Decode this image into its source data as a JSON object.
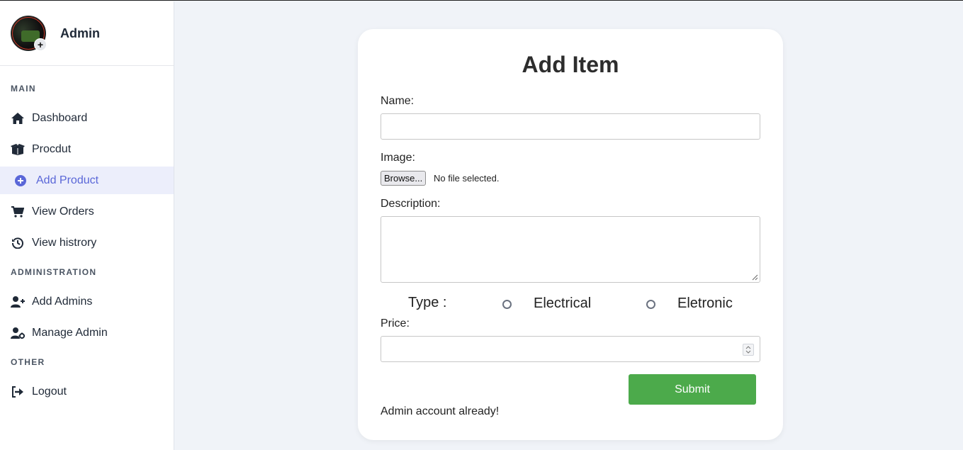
{
  "sidebar": {
    "profile_name": "Admin",
    "sections": {
      "main": "MAIN",
      "administration": "ADMINISTRATION",
      "other": "OTHER"
    },
    "items": {
      "dashboard": "Dashboard",
      "product": "Procdut",
      "add_product": "Add Product",
      "view_orders": "View Orders",
      "view_history": "View histrory",
      "add_admins": "Add Admins",
      "manage_admin": "Manage Admin",
      "logout": "Logout"
    }
  },
  "form": {
    "title": "Add Item",
    "name_label": "Name:",
    "name_value": "",
    "image_label": "Image:",
    "browse_label": "Browse...",
    "file_status": "No file selected.",
    "description_label": "Description:",
    "description_value": "",
    "type_label": "Type :",
    "type_options": [
      "Electrical",
      "Eletronic"
    ],
    "price_label": "Price:",
    "price_value": "",
    "submit_label": "Submit",
    "status_message": "Admin account already!"
  },
  "colors": {
    "accent": "#5a67d8",
    "submit": "#4caa4b",
    "background": "#f0f3f8"
  },
  "icons": {
    "dashboard": "home-icon",
    "product": "box-open-icon",
    "add_product": "plus-circle-icon",
    "view_orders": "cart-icon",
    "view_history": "history-icon",
    "add_admins": "user-plus-icon",
    "manage_admin": "user-gear-icon",
    "logout": "sign-out-icon"
  }
}
